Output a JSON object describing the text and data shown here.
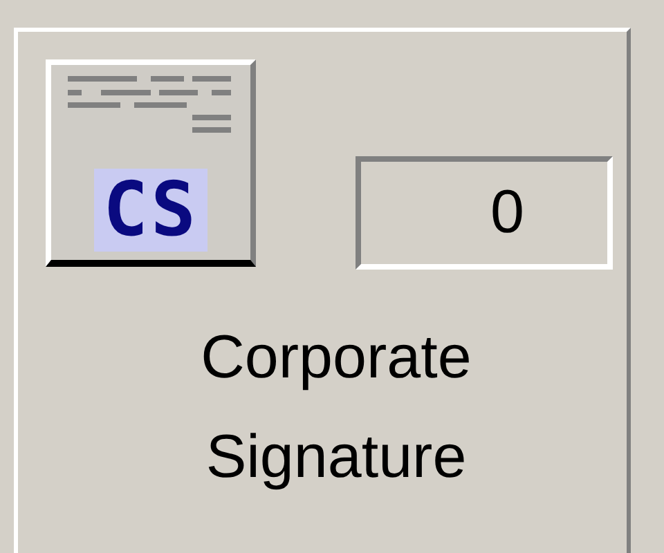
{
  "panel": {
    "button": {
      "label": "CS"
    },
    "counter": {
      "value": "0"
    },
    "caption": "Corporate Signature"
  }
}
